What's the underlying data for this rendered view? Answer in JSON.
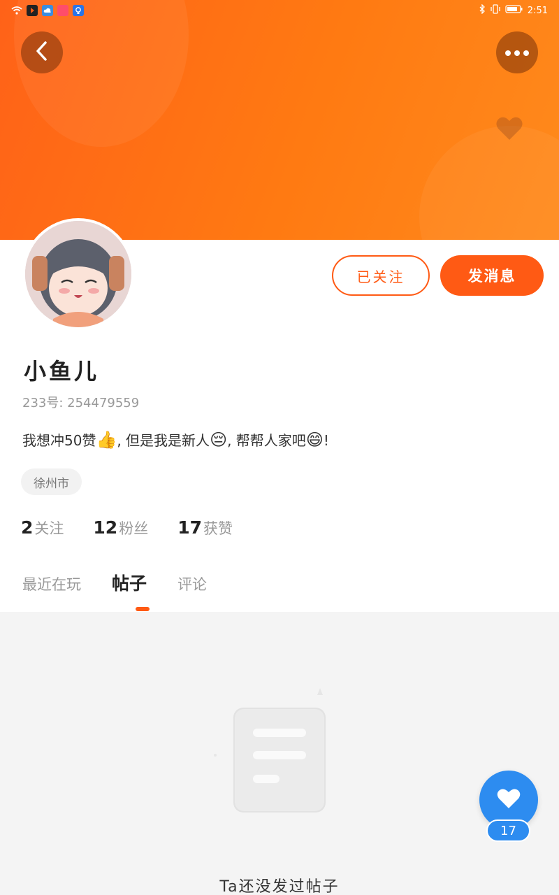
{
  "status_bar": {
    "time": "2:51",
    "left_icons": [
      "wifi-icon",
      "app-notification-icon",
      "cloud-icon",
      "app-icon",
      "bulb-icon"
    ],
    "right_icons": [
      "bluetooth-icon",
      "vibrate-icon",
      "battery-icon"
    ]
  },
  "header": {
    "back_icon": "chevron-left-icon",
    "more_icon": "more-dots-icon",
    "cover_icon": "heart-icon",
    "colors": {
      "cover_start": "#ff6218",
      "cover_end": "#ff8a1c"
    }
  },
  "profile": {
    "name": "小鱼儿",
    "id_text": "233号: 254479559",
    "bio_parts": [
      "我想冲50赞",
      "👍",
      ", 但是我是新人",
      "😔",
      ", 帮帮人家吧",
      "😄",
      "!"
    ],
    "location": "徐州市"
  },
  "actions": {
    "follow_label": "已关注",
    "message_label": "发消息",
    "accent": "#ff5a14"
  },
  "stats": [
    {
      "value": "2",
      "label": "关注"
    },
    {
      "value": "12",
      "label": "粉丝"
    },
    {
      "value": "17",
      "label": "获赞"
    }
  ],
  "tabs": [
    {
      "label": "最近在玩",
      "active": false
    },
    {
      "label": "帖子",
      "active": true
    },
    {
      "label": "评论",
      "active": false
    }
  ],
  "empty_state": {
    "icon": "document-icon",
    "message": "Ta还没发过帖子"
  },
  "like_fab": {
    "icon": "heart-icon",
    "count": "17",
    "color": "#2d8cf0"
  }
}
